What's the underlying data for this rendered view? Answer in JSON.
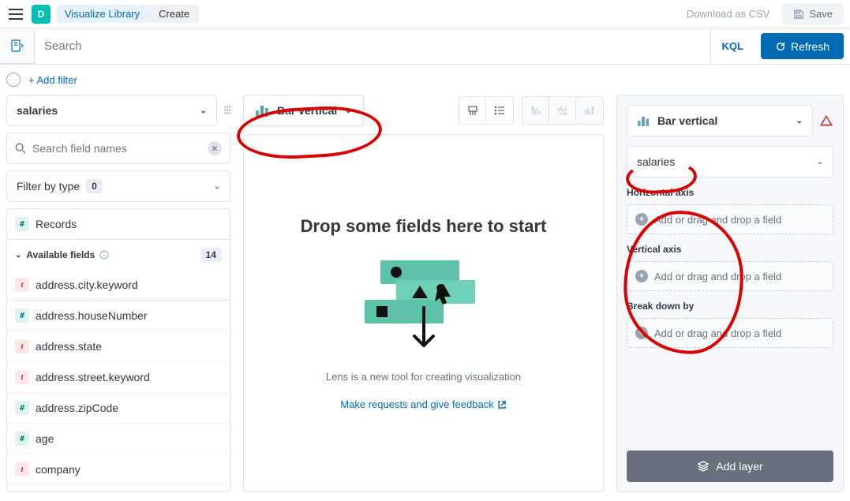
{
  "topbar": {
    "app_letter": "D",
    "crumb_library": "Visualize Library",
    "crumb_create": "Create",
    "download_csv": "Download as CSV",
    "save": "Save"
  },
  "filterbar": {
    "search_placeholder": "Search",
    "kql": "KQL",
    "refresh": "Refresh"
  },
  "add_filter": "+ Add filter",
  "left": {
    "index_pattern": "salaries",
    "search_placeholder": "Search field names",
    "filter_by_type": "Filter by type",
    "filter_count": "0",
    "records": "Records",
    "available_fields": "Available fields",
    "available_count": "14",
    "fields": [
      {
        "type": "t",
        "name": "address.city.keyword"
      },
      {
        "type": "#",
        "name": "address.houseNumber"
      },
      {
        "type": "t",
        "name": "address.state"
      },
      {
        "type": "t",
        "name": "address.street.keyword"
      },
      {
        "type": "#",
        "name": "address.zipCode"
      },
      {
        "type": "#",
        "name": "age"
      },
      {
        "type": "t",
        "name": "company"
      }
    ]
  },
  "mid": {
    "chart_type": "Bar vertical",
    "drop_headline": "Drop some fields here to start",
    "lens_sub": "Lens is a new tool for creating visualization",
    "feedback": "Make requests and give feedback"
  },
  "right": {
    "chart_type": "Bar vertical",
    "index_pattern": "salaries",
    "horizontal_axis": "Horizontal axis",
    "vertical_axis": "Vertical axis",
    "break_down_by": "Break down by",
    "add_field_hint": "Add or drag and drop a field",
    "add_layer": "Add layer"
  }
}
